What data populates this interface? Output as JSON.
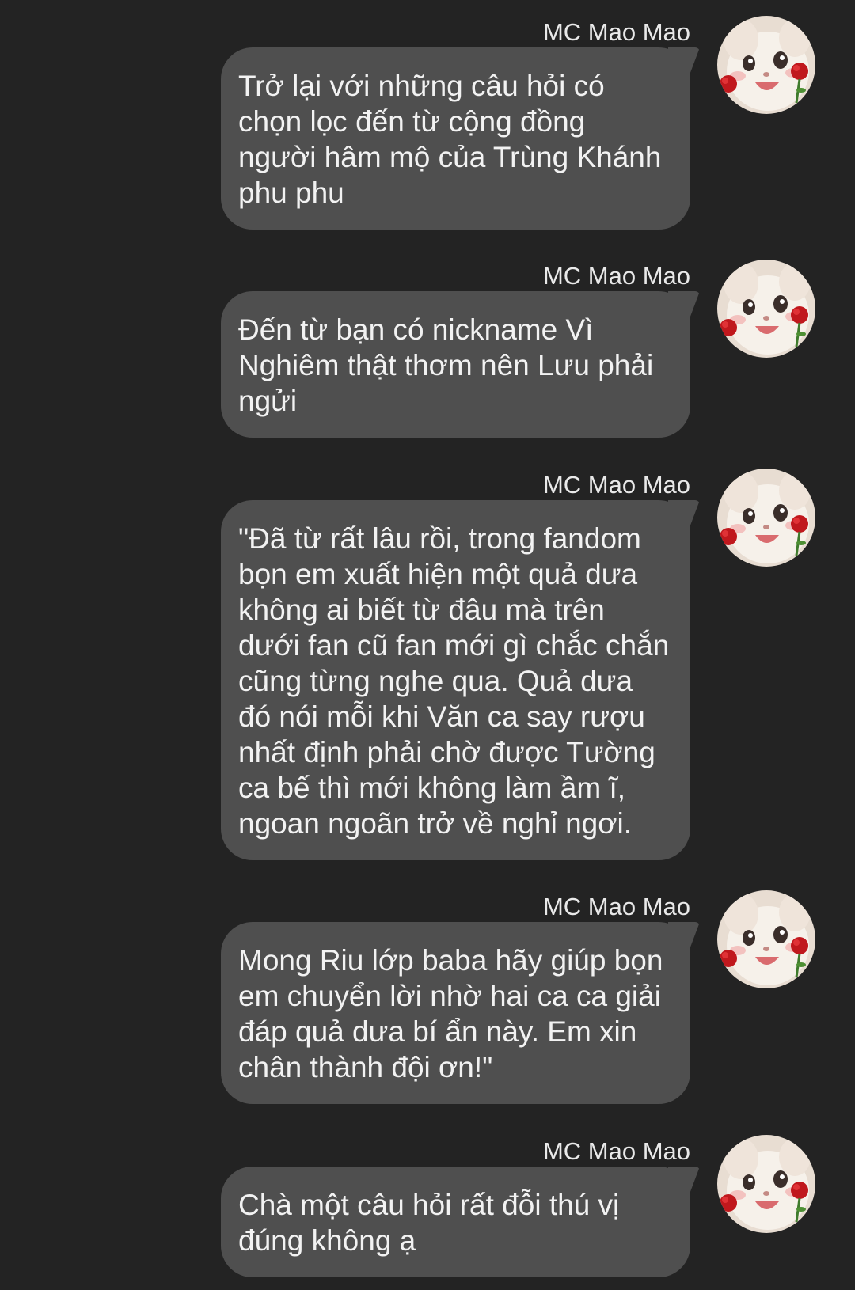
{
  "messages": [
    {
      "sender": "MC Mao Mao",
      "avatar_icon": "white-cat-with-roses-icon",
      "text": "Trở lại với những câu hỏi có\nchọn lọc đến từ cộng đồng\nngười hâm mộ của Trùng Khánh\nphu phu"
    },
    {
      "sender": "MC Mao Mao",
      "avatar_icon": "white-cat-with-roses-icon",
      "text": "Đến từ bạn có nickname Vì\nNghiêm thật thơm nên Lưu phải\nngửi"
    },
    {
      "sender": "MC Mao Mao",
      "avatar_icon": "white-cat-with-roses-icon",
      "text": "\"Đã từ rất lâu rồi, trong fandom\nbọn em xuất hiện một quả dưa\nkhông ai biết từ đâu mà trên\ndưới fan cũ fan mới gì chắc chắn\ncũng từng nghe qua. Quả dưa\nđó nói mỗi khi Văn ca say rượu\nnhất định phải chờ được Tường\nca bế thì mới không làm ầm ĩ,\nngoan ngoãn trở về nghỉ ngơi."
    },
    {
      "sender": "MC Mao Mao",
      "avatar_icon": "white-cat-with-roses-icon",
      "text": "Mong Riu lớp baba hãy giúp bọn\nem chuyển lời nhờ hai ca ca giải\nđáp quả dưa bí ẩn này. Em xin\nchân thành đội ơn!\""
    },
    {
      "sender": "MC Mao Mao",
      "avatar_icon": "white-cat-with-roses-icon",
      "text": "Chà một câu hỏi rất đỗi thú vị\nđúng không ạ"
    }
  ],
  "colors": {
    "background": "#232323",
    "bubble": "#4f4f4f",
    "text": "#f2f2f2"
  }
}
